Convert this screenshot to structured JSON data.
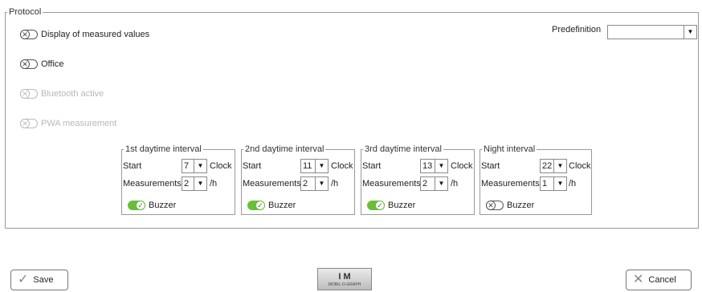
{
  "protocol": {
    "legend": "Protocol",
    "predefinition_label": "Predefinition",
    "predefinition_value": "",
    "toggles": [
      {
        "label": "Display of measured values",
        "state": "off",
        "enabled": true
      },
      {
        "label": "Office",
        "state": "off",
        "enabled": true
      },
      {
        "label": "Bluetooth active",
        "state": "off",
        "enabled": false
      },
      {
        "label": "PWA measurement",
        "state": "off",
        "enabled": false
      }
    ]
  },
  "intervals": [
    {
      "title": "1st daytime interval",
      "start_label": "Start",
      "start_value": "7",
      "start_unit": "Clock",
      "meas_label": "Measurements",
      "meas_value": "2",
      "meas_unit": "/h",
      "buzzer_label": "Buzzer",
      "buzzer_on": true
    },
    {
      "title": "2nd daytime interval",
      "start_label": "Start",
      "start_value": "11",
      "start_unit": "Clock",
      "meas_label": "Measurements",
      "meas_value": "2",
      "meas_unit": "/h",
      "buzzer_label": "Buzzer",
      "buzzer_on": true
    },
    {
      "title": "3rd daytime interval",
      "start_label": "Start",
      "start_value": "13",
      "start_unit": "Clock",
      "meas_label": "Measurements",
      "meas_value": "2",
      "meas_unit": "/h",
      "buzzer_label": "Buzzer",
      "buzzer_on": true
    },
    {
      "title": "Night interval",
      "start_label": "Start",
      "start_value": "22",
      "start_unit": "Clock",
      "meas_label": "Measurements",
      "meas_value": "1",
      "meas_unit": "/h",
      "buzzer_label": "Buzzer",
      "buzzer_on": false
    }
  ],
  "footer": {
    "save_label": "Save",
    "cancel_label": "Cancel",
    "logo_text": "I M",
    "logo_subtext": "MOBIL-O-GRAPH"
  },
  "icons": {
    "toggle_off": "x-mark",
    "toggle_on": "check-mark",
    "dropdown": "triangle-down",
    "save": "check-mark",
    "cancel": "x-mark"
  },
  "colors": {
    "toggle_on": "#6abf3a",
    "border": "#9a9a9a"
  }
}
